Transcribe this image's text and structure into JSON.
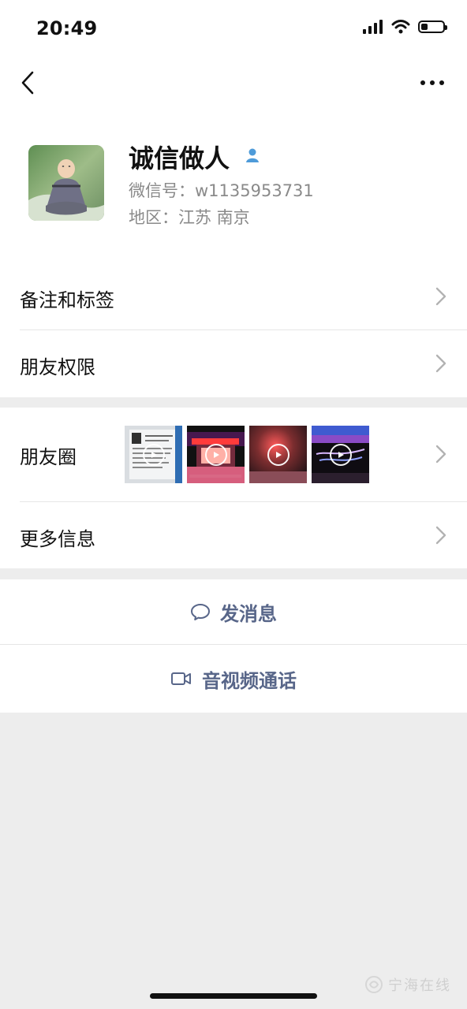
{
  "status_bar": {
    "time": "20:49"
  },
  "profile": {
    "name": "诚信做人",
    "wechat_id_label": "微信号：w1135953731",
    "region_label": "地区：江苏 南京"
  },
  "menu": {
    "remark_tags": "备注和标签",
    "friend_permissions": "朋友权限",
    "moments": "朋友圈",
    "more_info": "更多信息"
  },
  "actions": {
    "send_message": "发消息",
    "av_call": "音视频通话"
  },
  "watermark": {
    "text": "宁海在线"
  },
  "colors": {
    "background": "#ededed",
    "surface": "#ffffff",
    "action_blue": "#586689",
    "verified_blue": "#4e9bd9"
  }
}
